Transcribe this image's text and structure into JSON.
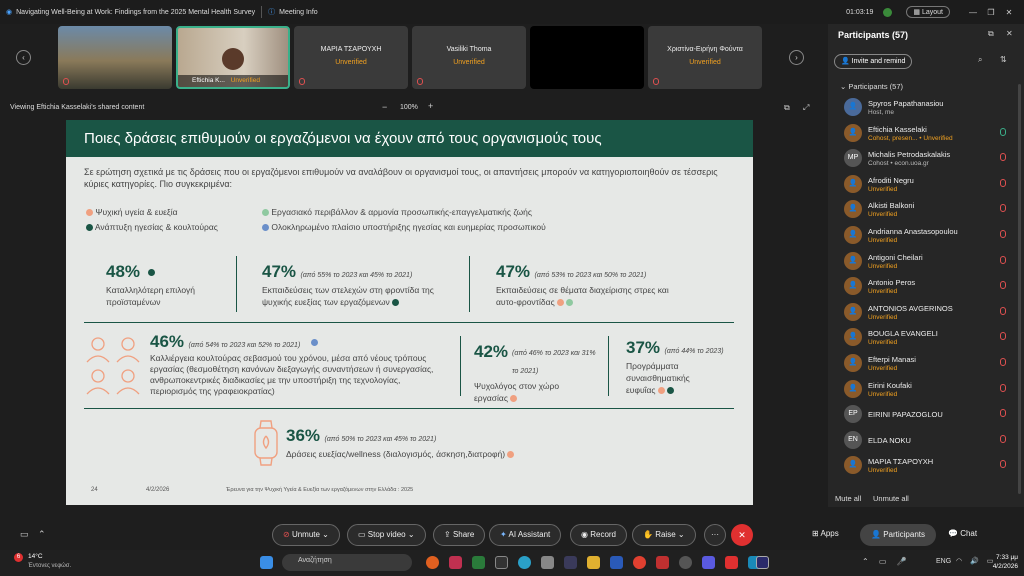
{
  "window": {
    "title": "Navigating Well-Being at Work: Findings from the 2025 Mental Health Survey",
    "meeting_info": "Meeting Info",
    "timer": "01:03:19",
    "layout": "Layout"
  },
  "strip": {
    "tiles": [
      {
        "name": "",
        "status": ""
      },
      {
        "name": "Eftichia K...",
        "status": "Unverified"
      },
      {
        "name": "ΜΑΡΙΑ ΤΣΑΡΟΥΧΗ",
        "status": "Unverified"
      },
      {
        "name": "Vasiliki Thoma",
        "status": "Unverified"
      },
      {
        "name": "",
        "status": ""
      },
      {
        "name": "Χριστίνα-Ειρήνη Φούντα",
        "status": "Unverified"
      }
    ]
  },
  "share": {
    "viewing": "Viewing Eftichia Kasselaki's shared content",
    "zoom": "100%",
    "minus": "−",
    "plus": "+"
  },
  "slide": {
    "title": "Ποιες δράσεις επιθυμούν οι εργαζόμενοι να έχουν από τους οργανισμούς τους",
    "intro": "Σε ερώτηση σχετικά με τις δράσεις που οι εργαζόμενοι επιθυμούν να αναλάβουν οι οργανισμοί τους, οι απαντήσεις μπορούν να κατηγοριοποιηθούν σε τέσσερις κύριες κατηγορίες. Πιο συγκεκριμένα:",
    "legend": [
      {
        "label": "Ψυχική υγεία & ευεξία",
        "color": "#f0a080"
      },
      {
        "label": "Εργασιακό περιβάλλον & αρμονία προσωπικής-επαγγελματικής ζωής",
        "color": "#8fc9a0"
      },
      {
        "label": "Ανάπτυξη ηγεσίας & κουλτούρας",
        "color": "#1a5545"
      },
      {
        "label": "Ολοκληρωμένο πλαίσιο υποστήριξης ηγεσίας και ευημερίας προσωπικού",
        "color": "#6a8fc9"
      }
    ],
    "stats": [
      {
        "pct": "48%",
        "note": "",
        "text": "Καταλληλότερη επιλογή προϊσταμένων"
      },
      {
        "pct": "47%",
        "note": "(από 55% το 2023 και 45% το 2021)",
        "text": "Εκπαιδεύσεις των στελεχών στη φροντίδα της ψυχικής ευεξίας των εργαζόμενων"
      },
      {
        "pct": "47%",
        "note": "(από 53% το 2023 και 50% το 2021)",
        "text": "Εκπαιδεύσεις σε θέματα διαχείρισης στρες και αυτο-φροντίδας"
      },
      {
        "pct": "46%",
        "note": "(από 54% το 2023 και 52% το 2021)",
        "text": "Καλλιέργεια κουλτούρας σεβασμού του χρόνου, μέσα από νέους τρόπους εργασίας (θεσμοθέτηση κανόνων διεξαγωγής συναντήσεων ή συνεργασίας, ανθρωποκεντρικές διαδικασίες με την υποστήριξη της τεχνολογίας, περιορισμός της γραφειοκρατίας)"
      },
      {
        "pct": "42%",
        "note": "(από 46% το 2023 και 31% το 2021)",
        "text": "Ψυχολόγος στον χώρο εργασίας"
      },
      {
        "pct": "37%",
        "note": "(από 44% το 2023)",
        "text": "Προγράμματα συναισθηματικής ευφυΐας"
      },
      {
        "pct": "36%",
        "note": "(από 50% το 2023 και 45% το 2021)",
        "text": "Δράσεις ευεξίας/wellness (διαλογισμός, άσκηση,διατροφή)"
      }
    ],
    "footer": {
      "page": "24",
      "date": "4/2/2026",
      "source": "Έρευνα για την Ψυχική Υγεία & Ευεξία των εργαζόμενων στην Ελλάδα : 2025"
    }
  },
  "panel": {
    "title": "Participants (57)",
    "invite": "Invite and remind",
    "section": "Participants (57)",
    "people": [
      {
        "name": "Spyros Papathanasiou",
        "sub": "Host, me",
        "init": ""
      },
      {
        "name": "Eftichia Kasselaki",
        "sub": "Cohost, presen... • Unverified",
        "init": ""
      },
      {
        "name": "Michalis Petrodaskalakis",
        "sub": "Cohost • econ.uoa.gr",
        "init": "MP"
      },
      {
        "name": "Afroditi Negru",
        "sub": "Unverified",
        "init": ""
      },
      {
        "name": "Alkisti Balkoni",
        "sub": "Unverified",
        "init": ""
      },
      {
        "name": "Andrianna Anastasopoulou",
        "sub": "Unverified",
        "init": ""
      },
      {
        "name": "Antigoni Cheilari",
        "sub": "Unverified",
        "init": ""
      },
      {
        "name": "Antonio Peros",
        "sub": "Unverified",
        "init": ""
      },
      {
        "name": "ANTONIOS AVGERINOS",
        "sub": "Unverified",
        "init": ""
      },
      {
        "name": "BOUGLA EVANGELI",
        "sub": "Unverified",
        "init": ""
      },
      {
        "name": "Efterpi Manasi",
        "sub": "Unverified",
        "init": ""
      },
      {
        "name": "Eirini Koufaki",
        "sub": "Unverified",
        "init": ""
      },
      {
        "name": "EIRINI PAPAZOGLOU",
        "sub": "",
        "init": "EP"
      },
      {
        "name": "ELDA NOKU",
        "sub": "",
        "init": "EN"
      },
      {
        "name": "ΜΑΡΙΑ ΤΣΑΡΟΥΧΗ",
        "sub": "Unverified",
        "init": ""
      }
    ],
    "mute_all": "Mute all",
    "unmute_all": "Unmute all"
  },
  "controls": {
    "unmute": "Unmute",
    "stop_video": "Stop video",
    "share": "Share",
    "ai": "AI Assistant",
    "record": "Record",
    "raise": "Raise",
    "more": "···",
    "apps": "Apps",
    "participants": "Participants",
    "chat": "Chat"
  },
  "taskbar": {
    "temp": "14°C",
    "weather": "Έντονες νεφώσ.",
    "search": "Αναζήτηση",
    "lang": "ENG",
    "time": "7:33 μμ",
    "date": "4/2/2026",
    "badge": "6"
  }
}
